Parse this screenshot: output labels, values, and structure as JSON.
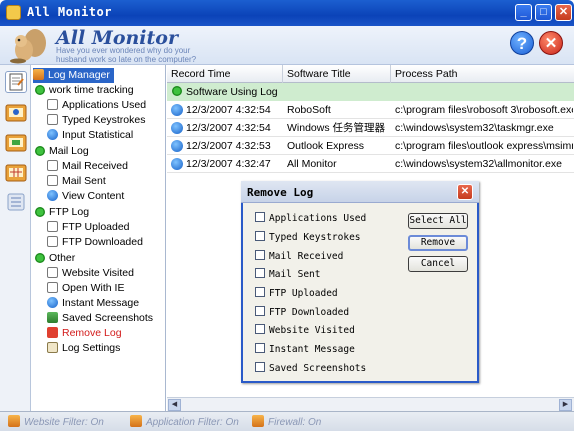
{
  "window": {
    "title": "All Monitor"
  },
  "header": {
    "brand": "All Monitor",
    "tagline": "Have you ever wondered why do your husband work so late on the computer?",
    "help_label": "?",
    "exit_label": "✕"
  },
  "tree": {
    "root": "Log Manager",
    "groups": [
      {
        "label": "work time tracking",
        "items": [
          "Applications Used",
          "Typed Keystrokes",
          "Input Statistical"
        ]
      },
      {
        "label": "Mail Log",
        "items": [
          "Mail Received",
          "Mail Sent",
          "View Content"
        ]
      },
      {
        "label": "FTP Log",
        "items": [
          "FTP Uploaded",
          "FTP Downloaded"
        ]
      },
      {
        "label": "Other",
        "items": [
          "Website Visited",
          "Open With IE",
          "Instant Message",
          "Saved Screenshots",
          "Remove Log",
          "Log Settings"
        ]
      }
    ]
  },
  "table": {
    "columns": [
      "Record Time",
      "Software Title",
      "Process Path"
    ],
    "group_label": "Software Using Log",
    "rows": [
      {
        "time": "12/3/2007 4:32:54",
        "title": "RoboSoft",
        "path": "c:\\program files\\robosoft 3\\robosoft.exe"
      },
      {
        "time": "12/3/2007 4:32:54",
        "title": "Windows 任务管理器",
        "path": "c:\\windows\\system32\\taskmgr.exe"
      },
      {
        "time": "12/3/2007 4:32:53",
        "title": "Outlook Express",
        "path": "c:\\program files\\outlook express\\msimn.exe"
      },
      {
        "time": "12/3/2007 4:32:47",
        "title": "All Monitor",
        "path": "c:\\windows\\system32\\allmonitor.exe"
      }
    ]
  },
  "dialog": {
    "title": "Remove Log",
    "close_label": "✕",
    "options": [
      "Applications Used",
      "Typed Keystrokes",
      "Mail Received",
      "Mail Sent",
      "FTP Uploaded",
      "FTP Downloaded",
      "Website Visited",
      "Instant Message",
      "Saved Screenshots"
    ],
    "buttons": {
      "select_all": "Select All",
      "remove": "Remove",
      "cancel": "Cancel"
    }
  },
  "status": {
    "website_filter": "Website Filter: On",
    "application_filter": "Application Filter: On",
    "firewall": "Firewall: On"
  },
  "colors": {
    "selection": "#2a65c8",
    "group_row": "#cfeccf",
    "accent_red": "#d21a1a"
  }
}
